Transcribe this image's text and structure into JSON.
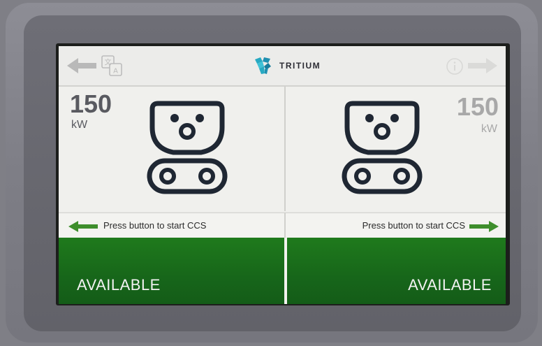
{
  "header": {
    "brand": "TRITIUM",
    "icons": {
      "back": "back-arrow-icon",
      "language": "language-icon",
      "info": "info-icon",
      "forward": "forward-arrow-icon"
    }
  },
  "connectors": [
    {
      "power_value": "150",
      "power_unit": "kW",
      "prompt": "Press button to start CCS",
      "status": "AVAILABLE",
      "icon": "ccs-connector-icon"
    },
    {
      "power_value": "150",
      "power_unit": "kW",
      "prompt": "Press button to start CCS",
      "status": "AVAILABLE",
      "icon": "ccs-connector-icon"
    }
  ],
  "colors": {
    "status_green": "#17661a",
    "arrow_green": "#3e8e2c",
    "brand_teal": "#27a9c2"
  }
}
